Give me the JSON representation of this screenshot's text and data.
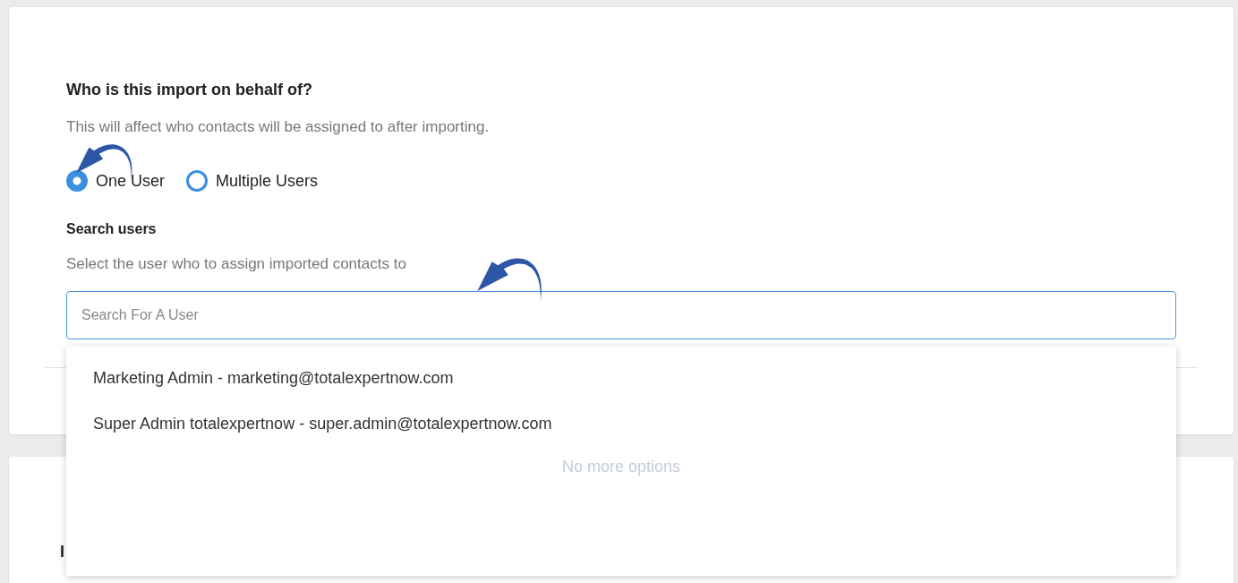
{
  "section": {
    "title": "Who is this import on behalf of?",
    "description": "This will affect who contacts will be assigned to after importing.",
    "options": [
      {
        "label": "One User",
        "selected": true
      },
      {
        "label": "Multiple Users",
        "selected": false
      }
    ]
  },
  "search": {
    "label": "Search users",
    "description": "Select the user who to assign imported contacts to",
    "placeholder": "Search For A User"
  },
  "dropdown": {
    "options": [
      "Marketing Admin - marketing@totalexpertnow.com",
      "Super Admin totalexpertnow - super.admin@totalexpertnow.com"
    ],
    "empty_note": "No more options"
  },
  "next_section": {
    "title": "I"
  }
}
